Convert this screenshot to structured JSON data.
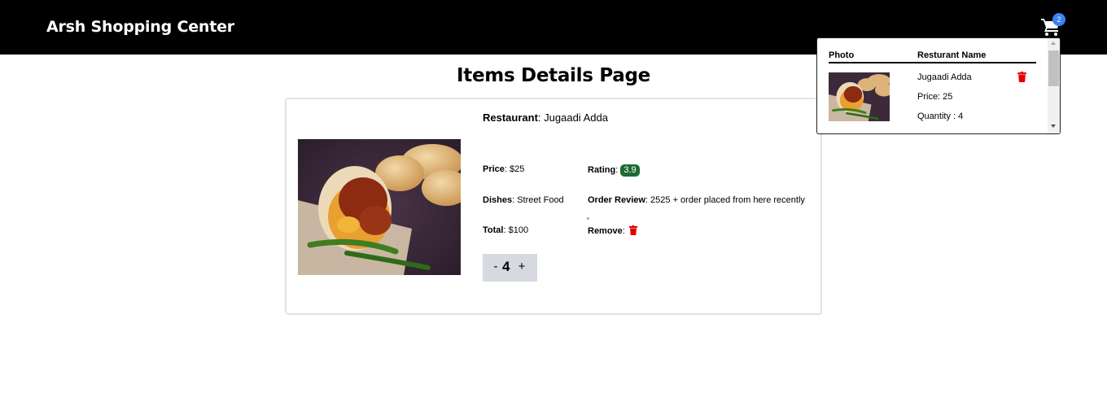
{
  "navbar": {
    "brand": "Arsh Shopping Center",
    "cart_icon": "shopping-cart-icon",
    "cart_count": "2",
    "background": "#000000"
  },
  "page": {
    "title": "Items Details Page"
  },
  "item": {
    "restaurant_label": "Restaurant",
    "restaurant_value": "Jugaadi Adda",
    "price_label": "Price",
    "price_value": "$25",
    "rating_label": "Rating",
    "rating_value": "3.9",
    "rating_color": "#1f6b33",
    "dishes_label": "Dishes",
    "dishes_value": "Street Food",
    "review_label": "Order Review",
    "review_value": "2525 + order placed from here recently",
    "total_label": "Total",
    "total_value": "$100",
    "remove_label": "Remove",
    "remove_icon": "trash-icon",
    "quantity": {
      "minus": "-",
      "value": "4",
      "plus": "+"
    }
  },
  "cart_popup": {
    "col_photo": "Photo",
    "col_name": "Resturant Name",
    "row": {
      "name": "Jugaadi Adda",
      "price": "Price: 25",
      "quantity": "Quantity : 4",
      "delete_icon": "trash-icon"
    }
  },
  "colors": {
    "accent_badge": "#3b82f6",
    "delete": "#e60000",
    "qty_bg": "#d6d9e0"
  }
}
